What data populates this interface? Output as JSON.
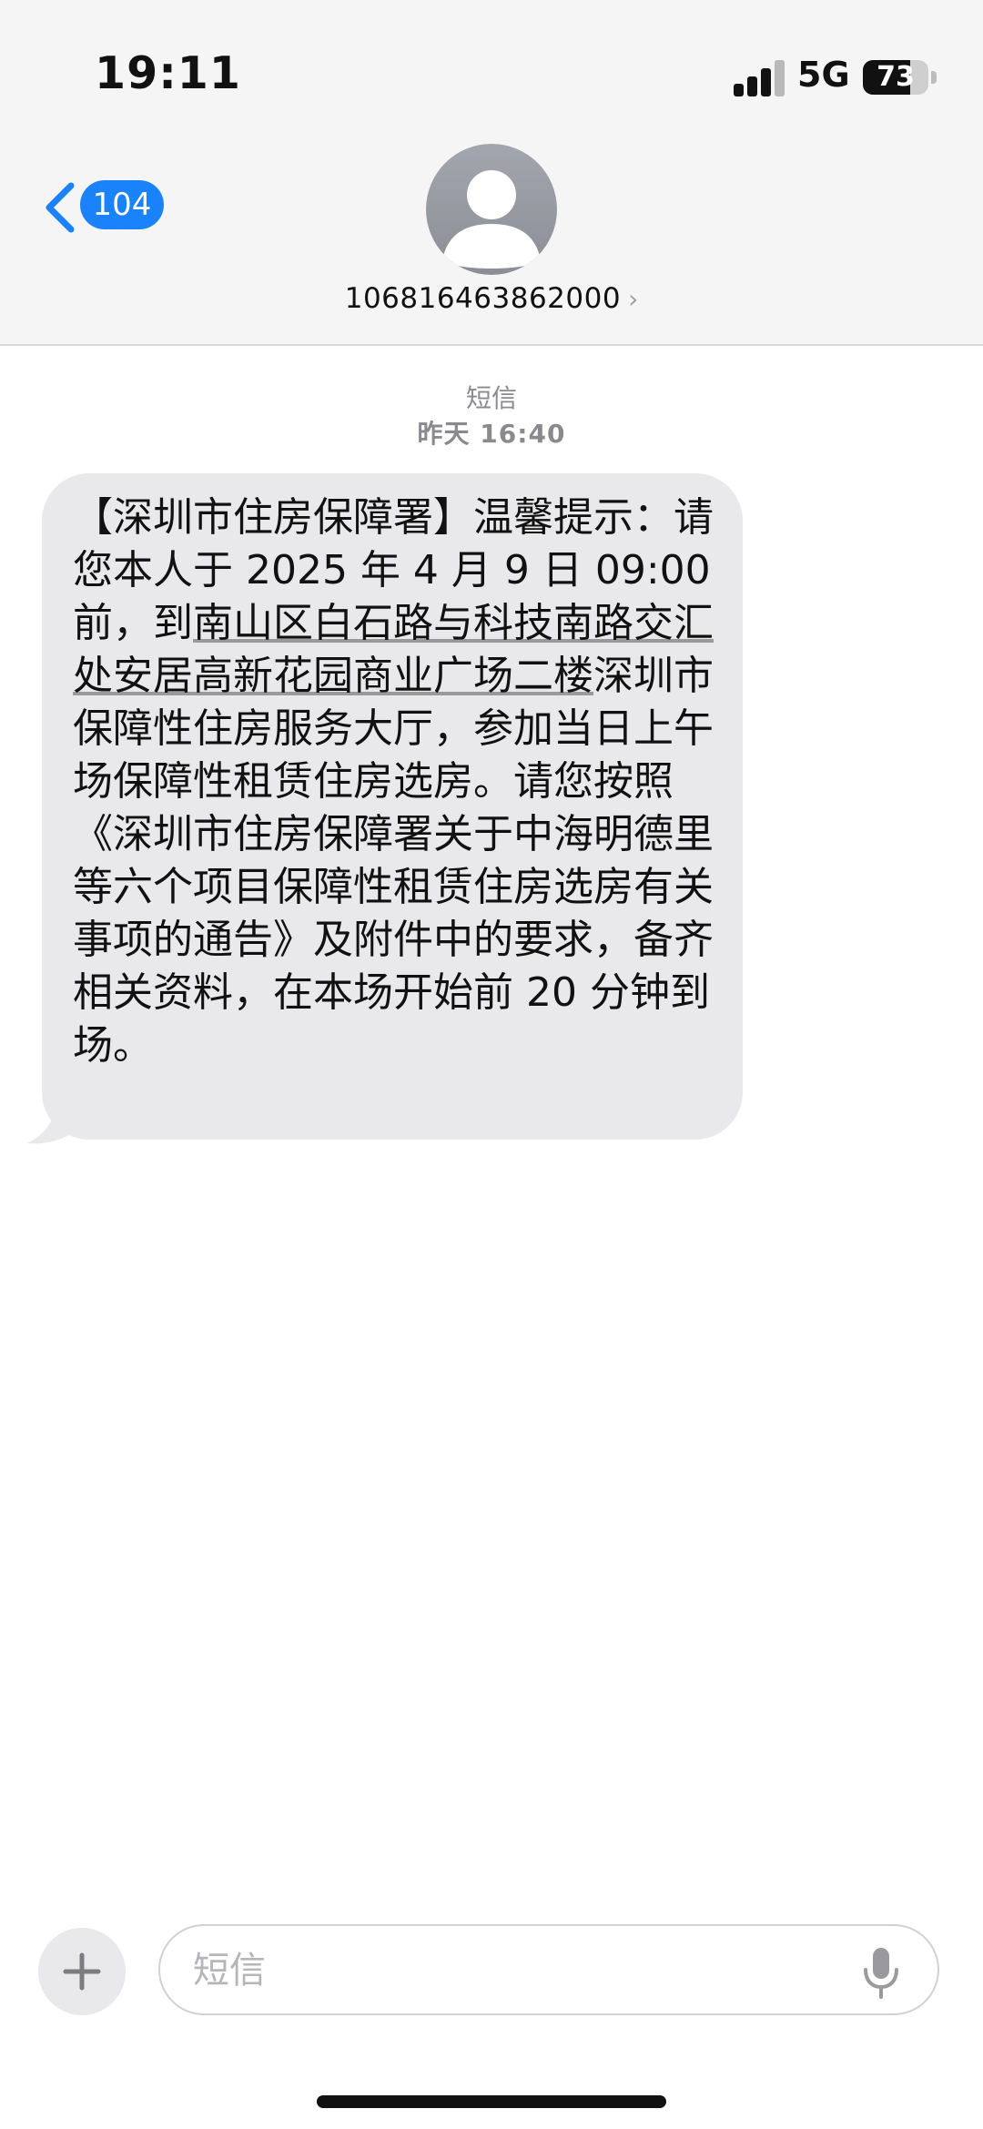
{
  "status_bar": {
    "time": "19:11",
    "network": "5G",
    "battery_percent": "73",
    "icons": [
      "signal-icon",
      "battery-icon"
    ]
  },
  "nav": {
    "back_count": "104",
    "contact_name": "106816463862000",
    "contact_chevron": "›",
    "icons": [
      "back-chevron-icon",
      "avatar-icon",
      "chevron-right-icon"
    ]
  },
  "conversation": {
    "service_label": "短信",
    "timestamp": "昨天 16:40"
  },
  "message": {
    "part1": "【深圳市住房保障署】温馨提示：请您本人于 2025 年 4 月 9 日 09:00 前，到",
    "link": "南山区白石路与科技南路交汇处安居高新花园商业广场二楼",
    "part2": "深圳市保障性住房服务大厅，参加当日上午场保障性租赁住房选房。请您按照《深圳市住房保障署关于中海明德里等六个项目保障性租赁住房选房有关事项的通告》及附件中的要求，备齐相关资料，在本场开始前 20 分钟到场。"
  },
  "composer": {
    "placeholder": "短信",
    "value": "",
    "icons": [
      "plus-icon",
      "microphone-icon"
    ]
  },
  "colors": {
    "accent": "#1a82fb",
    "bubble": "#e9e9eb",
    "header_bg": "#f5f5f5",
    "meta_text": "#8a8a8e"
  }
}
